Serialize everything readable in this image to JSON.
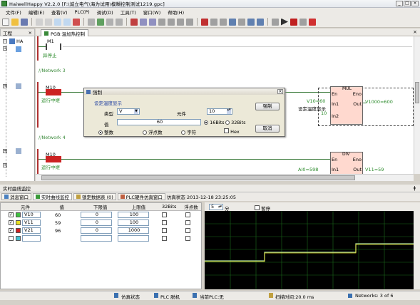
{
  "title": "HaiwellHappy V2.2.0 [F:\\诚立电气\\海为试用\\模糊控制测试1219.gpc]",
  "window_buttons": [
    "_",
    "□",
    "×"
  ],
  "menu": [
    "文件(F)",
    "编辑(E)",
    "查看(V)",
    "PLC(P)",
    "调试(D)",
    "工具(T)",
    "窗口(W)",
    "帮助(H)"
  ],
  "left_panel": {
    "title": "工程",
    "tree_root": "HA"
  },
  "doc_tab": "PGB:温加热控制",
  "ladder": {
    "m1": "M1",
    "stop_label": "异停止",
    "net3": "//Network 3",
    "m10a": "M10",
    "run_a": "运行中继",
    "net4": "//Network 4",
    "m10b": "M10",
    "run_b": "运行中继",
    "mul": {
      "name": "MUL",
      "en": "En",
      "eno": "Eno",
      "in1": "In1",
      "in2": "In2",
      "out": "Out",
      "in1_val": "V10=60",
      "in1_desc": "设定温度显示",
      "in2_val": "10",
      "out_val": "V1000=600"
    },
    "div": {
      "name": "DIV",
      "en": "En",
      "eno": "Eno",
      "in1": "In1",
      "out": "Out",
      "in1_val": "AI0=598",
      "out_val": "V11=59"
    }
  },
  "dialog": {
    "title": "强制",
    "caption": "设定温度显示",
    "type_label": "类型",
    "type_value": "V",
    "elem_label": "元件",
    "elem_value": "10",
    "value_label": "值",
    "value_value": "60",
    "bits16": "16Bits",
    "bits32": "32Bits",
    "int": "整数",
    "float": "浮点数",
    "char": "字符",
    "hex": "Hex",
    "force": "强制",
    "cancel": "取消"
  },
  "trend": {
    "title": "实时曲线监控",
    "tabs": [
      "消息窗口",
      "实时曲线监控",
      "锁定数据表 (0)",
      "PLC硬件仿真窗口",
      "仿真状态 2013-12-18 23:25:05"
    ],
    "columns": [
      "元件",
      "值",
      "下限值",
      "上限值",
      "32Bits",
      "浮点数"
    ],
    "rows": [
      {
        "checked": true,
        "color": "#40c040",
        "name": "V10",
        "value": "60",
        "low": "0",
        "high": "100"
      },
      {
        "checked": true,
        "color": "#e8e020",
        "name": "V11",
        "value": "59",
        "low": "0",
        "high": "100"
      },
      {
        "checked": true,
        "color": "#d02020",
        "name": "V21",
        "value": "96",
        "low": "0",
        "high": "1000"
      },
      {
        "checked": false,
        "color": "#40c0d0",
        "name": "",
        "value": "",
        "low": "",
        "high": ""
      }
    ],
    "interval": "5",
    "interval_unit": "分",
    "pause": "暂停"
  },
  "status": {
    "sim": "仿真状态",
    "plc": "PLC 脱机",
    "current": "当前PLC:无",
    "scan": "扫描时间:20.0 ms",
    "networks": "Networks: 3 of 6"
  }
}
